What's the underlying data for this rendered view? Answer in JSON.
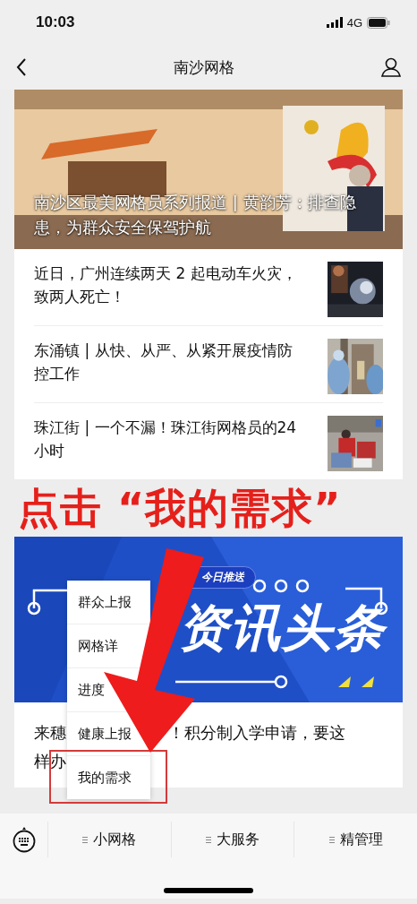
{
  "status_bar": {
    "time": "10:03",
    "network": "4G"
  },
  "nav": {
    "title": "南沙网格"
  },
  "feature": {
    "caption": "南沙区最美网格员系列报道 | 黄韵芳：排查隐患，为群众安全保驾护航"
  },
  "news": [
    {
      "title": "近日，广州连续两天 2 起电动车火灾，致两人死亡！"
    },
    {
      "title": "东涌镇 | 从快、从严、从紧开展疫情防控工作"
    },
    {
      "title": "珠江街 | 一个不漏！珠江街网格员的24小时"
    }
  ],
  "annotation": {
    "text": "点击 “我的需求”"
  },
  "banner": {
    "badge": "今日推送",
    "headline": "资讯头条"
  },
  "article": {
    "title_parts": [
      "来穗",
      "！积分制入学申请，要这",
      "样办"
    ]
  },
  "menu": {
    "items": [
      {
        "label": "群众上报",
        "selected": false
      },
      {
        "label": "网格详",
        "selected": false
      },
      {
        "label": "进度",
        "selected": false
      },
      {
        "label": "健康上报",
        "selected": false
      },
      {
        "label": "我的需求",
        "selected": true
      }
    ]
  },
  "tab_bar": {
    "items": [
      "小网格",
      "大服务",
      "精管理"
    ]
  }
}
